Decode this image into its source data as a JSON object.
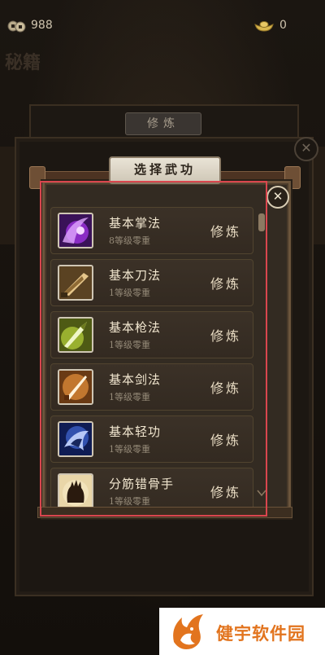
{
  "topbar": {
    "coins": "988",
    "ingots": "0"
  },
  "background": {
    "ghost_text": "秘籍",
    "back_title": "修炼",
    "close_glyph": "✕"
  },
  "dialog": {
    "title": "选择武功",
    "close_glyph": "✕"
  },
  "skills": [
    {
      "name": "基本掌法",
      "level": "8等级零重",
      "action": "修炼",
      "icon": "palm-skill-icon"
    },
    {
      "name": "基本刀法",
      "level": "1等级零重",
      "action": "修炼",
      "icon": "saber-skill-icon"
    },
    {
      "name": "基本枪法",
      "level": "1等级零重",
      "action": "修炼",
      "icon": "spear-skill-icon"
    },
    {
      "name": "基本剑法",
      "level": "1等级零重",
      "action": "修炼",
      "icon": "sword-skill-icon"
    },
    {
      "name": "基本轻功",
      "level": "1等级零重",
      "action": "修炼",
      "icon": "lightness-skill-icon"
    },
    {
      "name": "分筋错骨手",
      "level": "1等级零重",
      "action": "修炼",
      "icon": "claw-skill-icon"
    }
  ],
  "watermark": {
    "text": "健宇软件园"
  },
  "colors": {
    "highlight": "#d9464e",
    "panel": "#332b22",
    "watermark": "#e2741e"
  }
}
